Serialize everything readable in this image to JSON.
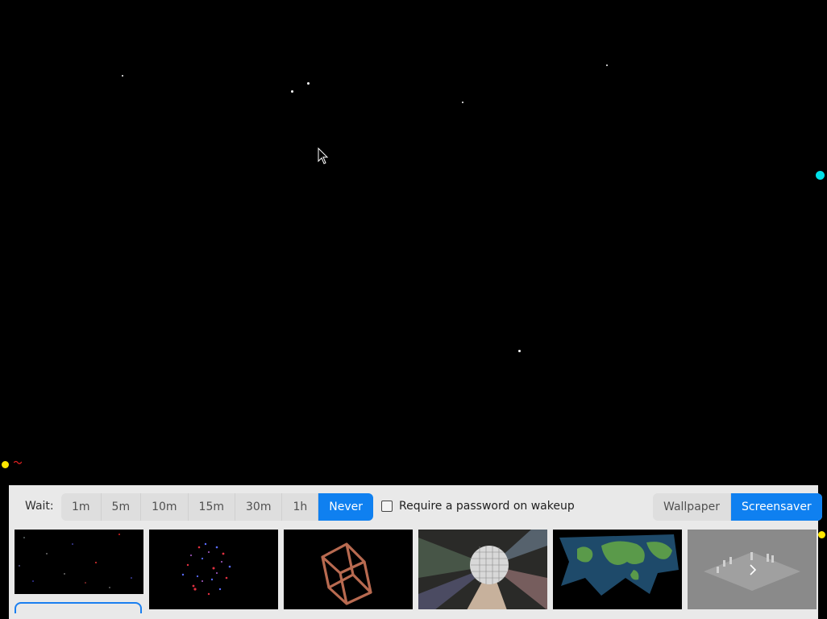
{
  "panel": {
    "wait_label": "Wait:",
    "wait_options": [
      "1m",
      "5m",
      "10m",
      "15m",
      "30m",
      "1h",
      "Never"
    ],
    "wait_selected": "Never",
    "password_label": "Require a password on wakeup",
    "password_checked": false,
    "mode_options": [
      "Wallpaper",
      "Screensaver"
    ],
    "mode_selected": "Screensaver"
  },
  "thumbnails": [
    {
      "name": "starfield",
      "icon": "starfield-thumbnail"
    },
    {
      "name": "particles",
      "icon": "particles-sphere-thumbnail"
    },
    {
      "name": "cube",
      "icon": "wire-cube-thumbnail"
    },
    {
      "name": "disco-ball",
      "icon": "disco-ball-thumbnail"
    },
    {
      "name": "world-map",
      "icon": "world-map-thumbnail"
    },
    {
      "name": "chess",
      "icon": "chess-board-thumbnail",
      "overlay_icon": "chevron-right-icon"
    }
  ],
  "colors": {
    "accent": "#0f80f0",
    "panel_bg": "#e9e9e9",
    "screen_bg": "#000000",
    "dot_yellow": "#ffe600",
    "dot_cyan": "#00e0e8"
  }
}
